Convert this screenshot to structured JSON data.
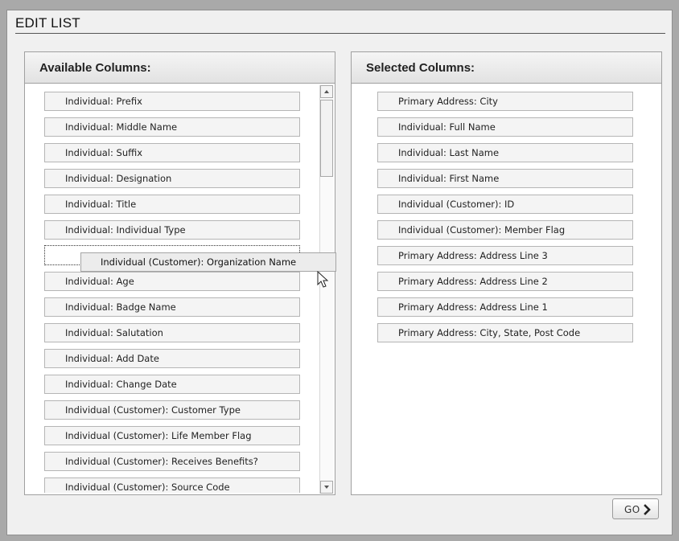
{
  "title": "EDIT LIST",
  "available": {
    "header": "Available Columns:",
    "items": [
      "Individual: Prefix",
      "Individual: Middle Name",
      "Individual: Suffix",
      "Individual: Designation",
      "Individual: Title",
      "Individual: Individual Type",
      "Individual: Age",
      "Individual: Badge Name",
      "Individual: Salutation",
      "Individual: Add Date",
      "Individual: Change Date",
      "Individual (Customer): Customer Type",
      "Individual (Customer): Life Member Flag",
      "Individual (Customer): Receives Benefits?",
      "Individual (Customer): Source Code"
    ],
    "dragging": "Individual (Customer): Organization Name"
  },
  "selected": {
    "header": "Selected Columns:",
    "items": [
      "Primary Address: City",
      "Individual: Full Name",
      "Individual: Last Name",
      "Individual: First Name",
      "Individual (Customer): ID",
      "Individual (Customer): Member Flag",
      "Primary Address: Address Line 3",
      "Primary Address: Address Line 2",
      "Primary Address: Address Line 1",
      "Primary Address: City, State, Post Code"
    ]
  },
  "go_button": {
    "label": "GO",
    "icon": "chevron-right-icon"
  }
}
